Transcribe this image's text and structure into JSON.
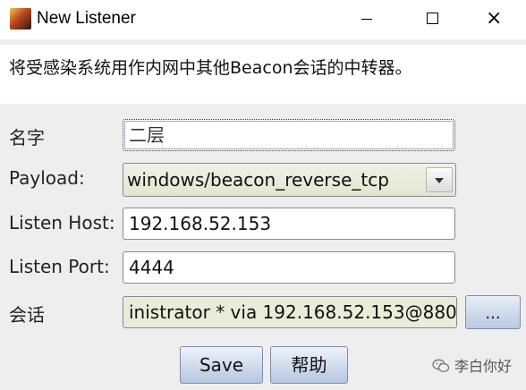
{
  "window": {
    "title": "New Listener",
    "minimize_symbol": "",
    "maximize_symbol": "",
    "close_symbol": "×"
  },
  "description": "将受感染系统用作内网中其他Beacon会话的中转器。",
  "form": {
    "name": {
      "label": "名字",
      "value": "二层"
    },
    "payload": {
      "label": "Payload:",
      "value": "windows/beacon_reverse_tcp"
    },
    "listen_host": {
      "label": "Listen Host:",
      "value": "192.168.52.153"
    },
    "listen_port": {
      "label": "Listen Port:",
      "value": "4444"
    },
    "session": {
      "label": "会话",
      "value": "inistrator * via  192.168.52.153@880",
      "browse_label": "..."
    }
  },
  "buttons": {
    "save": "Save",
    "help": "帮助"
  },
  "watermark": "李白你好",
  "colors": {
    "titlebar_bg": "#ffffff",
    "window_bg": "#eeeeee",
    "select_bg": "#e2e6cf",
    "button_gradient_top": "#eef3fb",
    "button_gradient_bottom": "#b5c6df"
  },
  "icons": {
    "app": "cobalt-strike-app-icon",
    "dropdown": "chevron-down-icon",
    "watermark": "wechat-icon"
  }
}
